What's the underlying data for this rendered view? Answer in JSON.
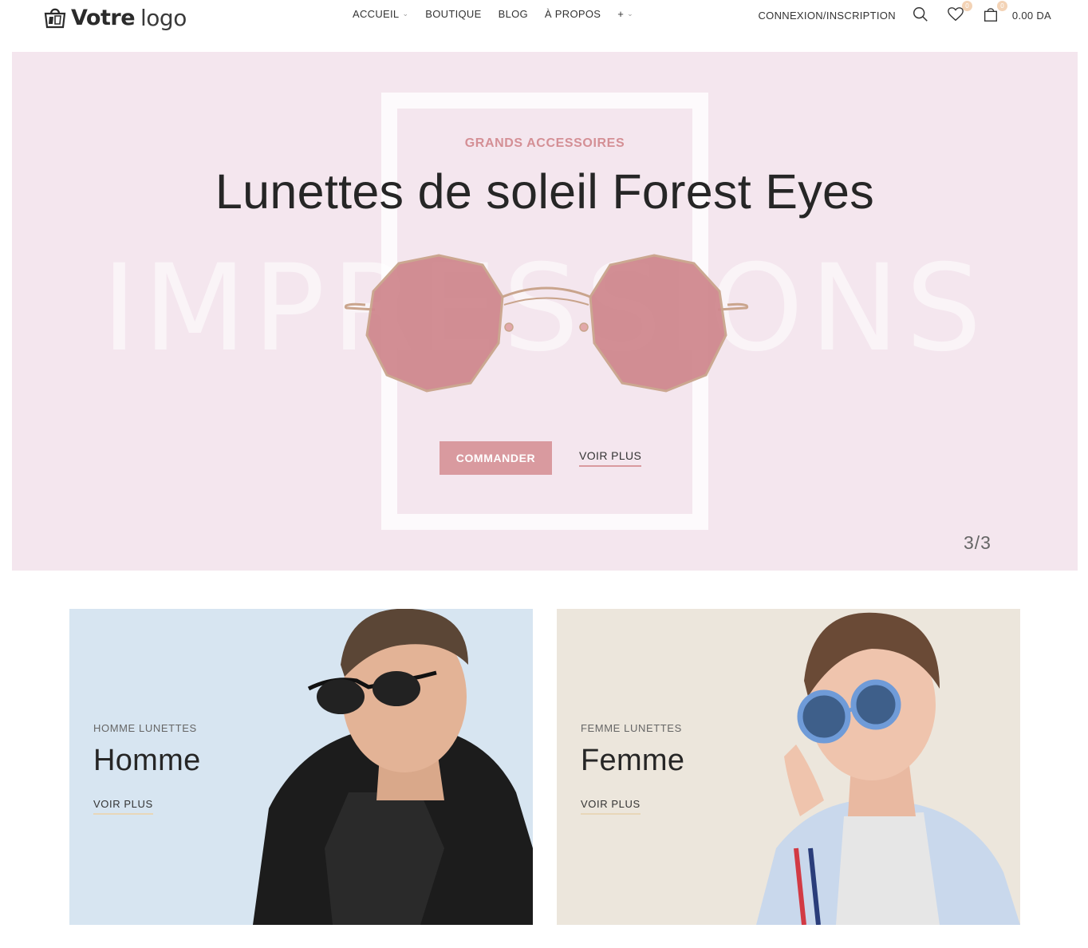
{
  "header": {
    "logo_bold": "Votre",
    "logo_light": "logo",
    "nav": [
      {
        "label": "ACCUEIL",
        "has_dropdown": true
      },
      {
        "label": "BOUTIQUE",
        "has_dropdown": false
      },
      {
        "label": "BLOG",
        "has_dropdown": false
      },
      {
        "label": "À PROPOS",
        "has_dropdown": false
      },
      {
        "label": "+",
        "has_dropdown": true
      }
    ],
    "login_label": "CONNEXION/INSCRIPTION",
    "wishlist_count": "0",
    "cart_count": "0",
    "cart_total": "0.00 DA"
  },
  "hero": {
    "kicker": "GRANDS ACCESSOIRES",
    "title": "Lunettes de soleil Forest Eyes",
    "background_word": "IMPRESSIONS",
    "primary_button": "COMMANDER",
    "secondary_link": "VOIR PLUS",
    "slide_counter": "3/3"
  },
  "categories": [
    {
      "kicker": "HOMME LUNETTES",
      "title": "Homme",
      "link": "VOIR PLUS"
    },
    {
      "kicker": "FEMME LUNETTES",
      "title": "Femme",
      "link": "VOIR PLUS"
    }
  ],
  "colors": {
    "accent": "#d99a9f",
    "hero_bg": "#f4e6ee",
    "men_card_bg": "#d7e5f1",
    "women_card_bg": "#ece6dc",
    "badge": "#f3d3b6"
  }
}
